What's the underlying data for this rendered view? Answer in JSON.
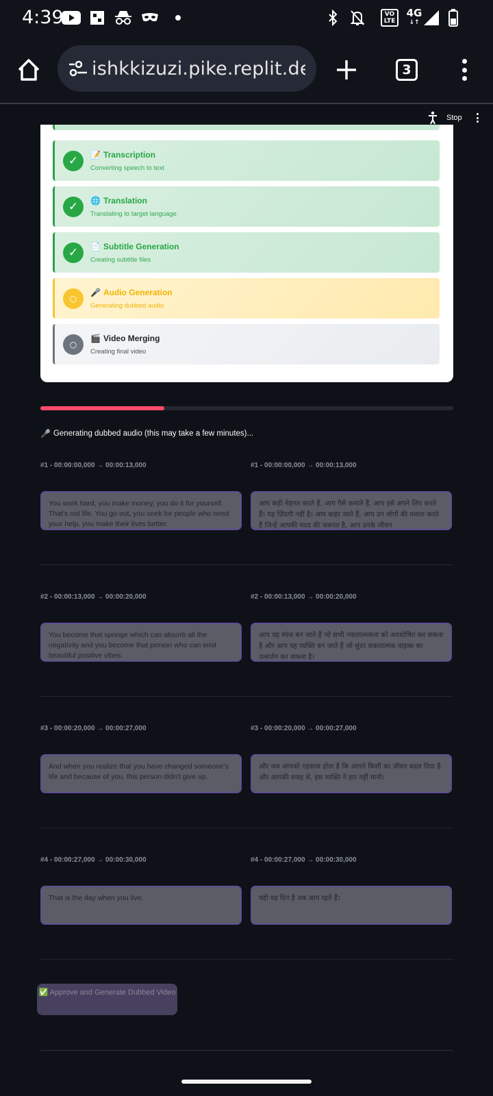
{
  "status_bar": {
    "time": "4:39",
    "vo": "VO",
    "lte": "LTE",
    "network": "4G",
    "network_arrows": "↓↑",
    "icons": [
      "youtube-icon",
      "app-icon",
      "incognito-icon",
      "mask-icon",
      "dot-icon",
      "bluetooth-icon",
      "alarm-off-icon",
      "signal-icon",
      "battery-icon"
    ]
  },
  "browser": {
    "url": "ishkkizuzi.pike.replit.dev",
    "tab_count": "3"
  },
  "toolbar": {
    "stop_label": "Stop"
  },
  "steps": [
    {
      "emoji": "📝",
      "title": "Transcription",
      "desc": "Converting speech to text",
      "state": "done",
      "mark": "✓"
    },
    {
      "emoji": "🌐",
      "title": "Translation",
      "desc": "Translating to target language",
      "state": "done",
      "mark": "✓"
    },
    {
      "emoji": "📄",
      "title": "Subtitle Generation",
      "desc": "Creating subtitle files",
      "state": "done",
      "mark": "✓"
    },
    {
      "emoji": "🎤",
      "title": "Audio Generation",
      "desc": "Generating dubbed audio",
      "state": "active",
      "mark": "○"
    },
    {
      "emoji": "🎬",
      "title": "Video Merging",
      "desc": "Creating final video",
      "state": "pending",
      "mark": "○"
    }
  ],
  "progress": {
    "fraction": 0.3,
    "emoji": "🎤",
    "text": "Generating dubbed audio (this may take a few minutes)..."
  },
  "segments": [
    {
      "label": "#1 - 00:00:00,000 → 00:00:13,000",
      "english": "You work hard, you make money, you do it for yourself. That's not life. You go out, you seek for people who need your help, you make their lives better.",
      "hindi": "आप कड़ी मेहनत करते हैं, आप पैसे कमाते हैं, आप इसे अपने लिए करते हैं। यह ज़िंदगी नहीं है। आप बाहर जाते हैं, आप उन लोगों की तलाश करते हैं जिन्हें आपकी मदद की जरूरत है, आप उनके जीवन"
    },
    {
      "label": "#2 - 00:00:13,000 → 00:00:20,000",
      "english": "You become that sponge which can absorb all the negativity and you become that person who can emit beautiful positive vibes.",
      "hindi": "आप वह स्पंज बन जाते हैं जो सभी नकारात्मकता को अवशोषित कर सकता है और आप वह व्यक्ति बन जाते हैं जो सुंदर सकारात्मक वाइब्स का उत्सर्जन कर सकता है।"
    },
    {
      "label": "#3 - 00:00:20,000 → 00:00:27,000",
      "english": "And when you realize that you have changed someone's life and because of you, this person didn't give up.",
      "hindi": "और जब आपको एहसास होता है कि आपने किसी का जीवन बदल दिया है और आपकी वजह से, इस व्यक्ति ने हार नहीं मानी।"
    },
    {
      "label": "#4 - 00:00:27,000 → 00:00:30,000",
      "english": "That is the day when you live.",
      "hindi": "यही वह दिन है जब आप रहते हैं।"
    }
  ],
  "approve_button": "✅ Approve and Generate Dubbed Video",
  "colors": {
    "background": "#0e1117",
    "success": "#28a745",
    "warning": "#f8c630",
    "pending": "#6c757d",
    "progress": "#ff4b6b",
    "textarea_border": "#5d4e93"
  }
}
